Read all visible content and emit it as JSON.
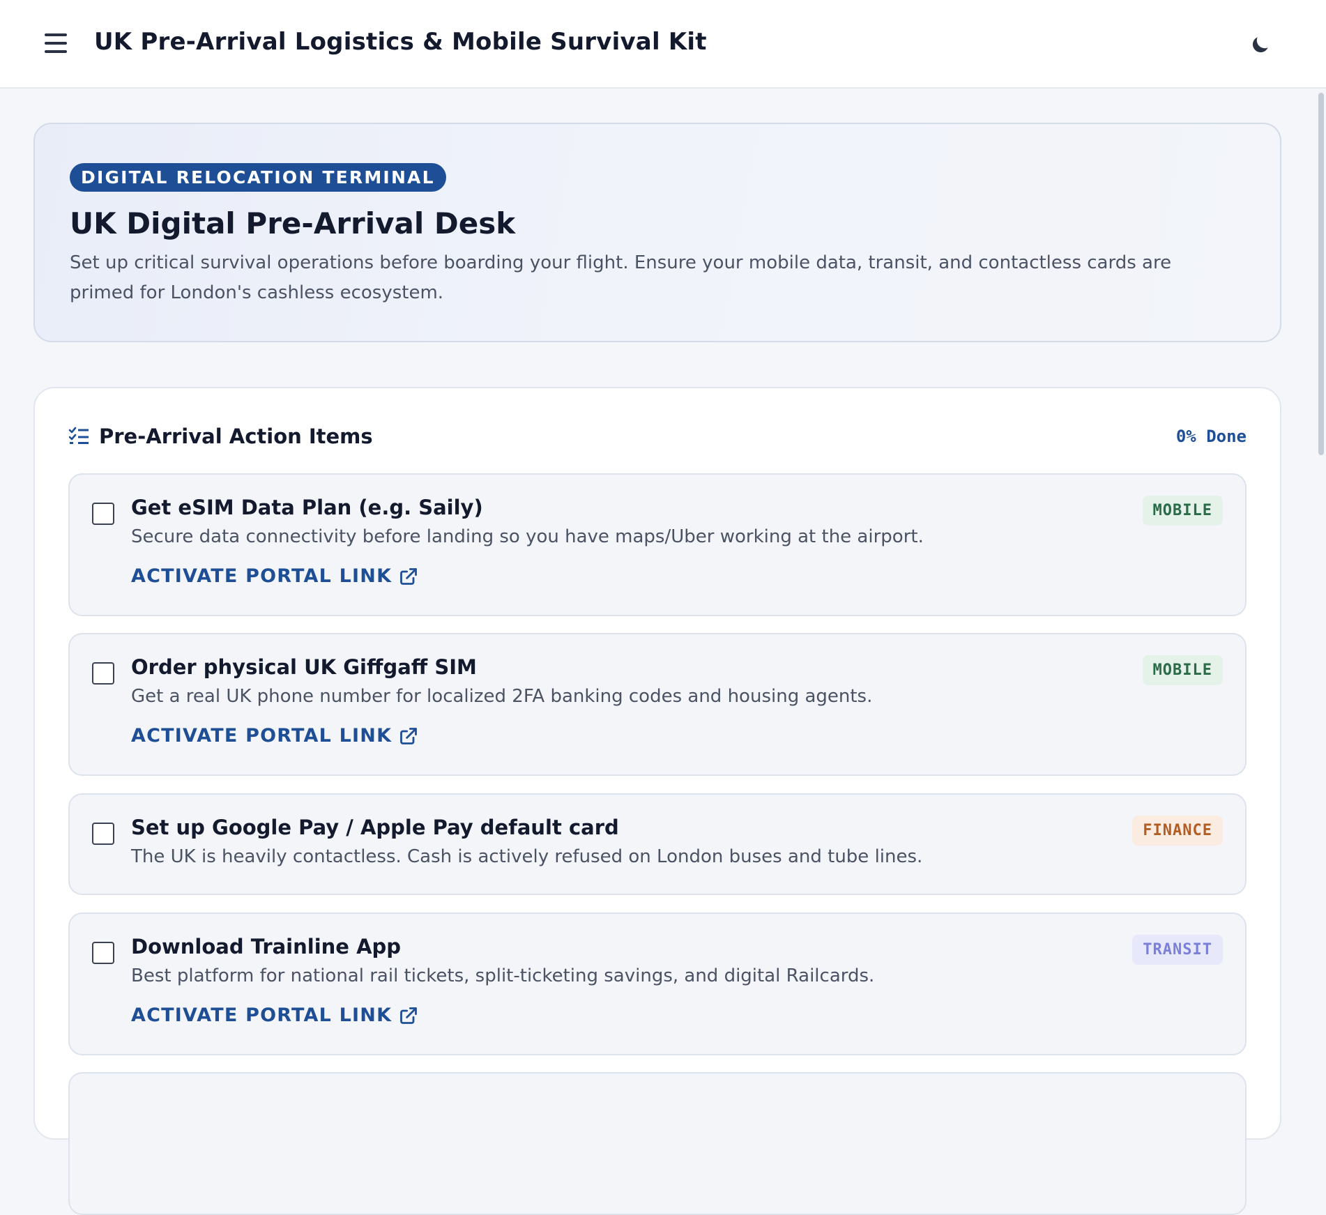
{
  "header": {
    "title": "UK Pre-Arrival Logistics & Mobile Survival Kit",
    "menu_icon": "hamburger-menu-icon",
    "theme_icon": "moon-icon"
  },
  "hero": {
    "badge": "DIGITAL RELOCATION TERMINAL",
    "title": "UK Digital Pre-Arrival Desk",
    "description": "Set up critical survival operations before boarding your flight. Ensure your mobile data, transit, and contactless cards are primed for London's cashless ecosystem."
  },
  "checklist": {
    "icon": "checklist-icon",
    "title": "Pre-Arrival Action Items",
    "progress": "0% Done",
    "items": [
      {
        "title": "Get eSIM Data Plan (e.g. Saily)",
        "description": "Secure data connectivity before landing so you have maps/Uber working at the airport.",
        "tag": "MOBILE",
        "link_label": "ACTIVATE PORTAL LINK",
        "checked": false
      },
      {
        "title": "Order physical UK Giffgaff SIM",
        "description": "Get a real UK phone number for localized 2FA banking codes and housing agents.",
        "tag": "MOBILE",
        "link_label": "ACTIVATE PORTAL LINK",
        "checked": false
      },
      {
        "title": "Set up Google Pay / Apple Pay default card",
        "description": "The UK is heavily contactless. Cash is actively refused on London buses and tube lines.",
        "tag": "FINANCE",
        "checked": false
      },
      {
        "title": "Download Trainline App",
        "description": "Best platform for national rail tickets, split-ticketing savings, and digital Railcards.",
        "tag": "TRANSIT",
        "link_label": "ACTIVATE PORTAL LINK",
        "checked": false
      }
    ]
  },
  "colors": {
    "accent": "#1e4f96",
    "mobile_tag": "#2a6b48",
    "finance_tag": "#b35d22",
    "transit_tag": "#7a7fd8"
  }
}
